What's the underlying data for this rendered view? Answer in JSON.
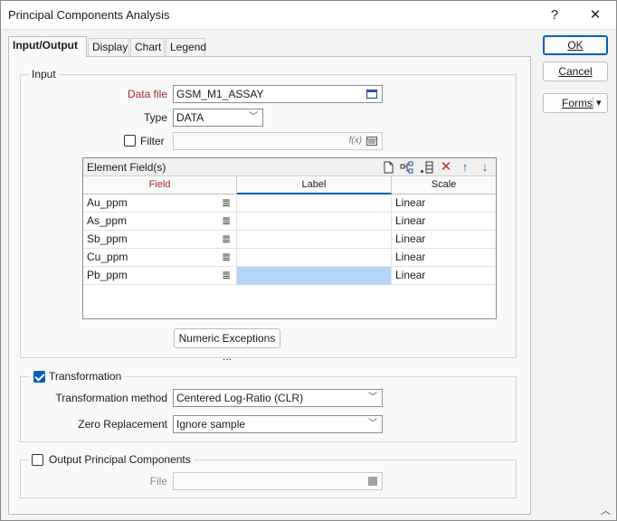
{
  "window": {
    "title": "Principal Components Analysis",
    "help_glyph": "?",
    "close_glyph": "✕"
  },
  "tabs": [
    "Input/Output",
    "Display",
    "Chart",
    "Legend"
  ],
  "buttons": {
    "ok": "OK",
    "cancel": "Cancel",
    "forms": "Forms",
    "forms_arrow": "▾",
    "numeric_exceptions": "Numeric Exceptions ..."
  },
  "input": {
    "group_title": "Input",
    "data_file_label": "Data file",
    "data_file_value": "GSM_M1_ASSAY",
    "type_label": "Type",
    "type_value": "DATA",
    "filter_label": "Filter",
    "filter_value": "",
    "filter_fx": "f(x)"
  },
  "element_fields": {
    "title": "Element Field(s)",
    "columns": [
      "Field",
      "Label",
      "Scale"
    ],
    "rows": [
      {
        "field": "Au_ppm",
        "label": "",
        "scale": "Linear"
      },
      {
        "field": "As_ppm",
        "label": "",
        "scale": "Linear"
      },
      {
        "field": "Sb_ppm",
        "label": "",
        "scale": "Linear"
      },
      {
        "field": "Cu_ppm",
        "label": "",
        "scale": "Linear"
      },
      {
        "field": "Pb_ppm",
        "label": "",
        "scale": "Linear"
      }
    ],
    "selected_row": 4,
    "menu_glyph": "≣"
  },
  "transformation": {
    "group_title": "Transformation",
    "checked": true,
    "method_label": "Transformation method",
    "method_value": "Centered Log-Ratio (CLR)",
    "zero_label": "Zero Replacement",
    "zero_value": "Ignore sample"
  },
  "output": {
    "group_title": "Output Principal Components",
    "checked": false,
    "file_label": "File",
    "file_value": ""
  },
  "colors": {
    "accent": "#005fb8",
    "required_label": "#a4262c",
    "selected_cell": "#b3d5f7",
    "delete_icon": "#c42b1c"
  }
}
